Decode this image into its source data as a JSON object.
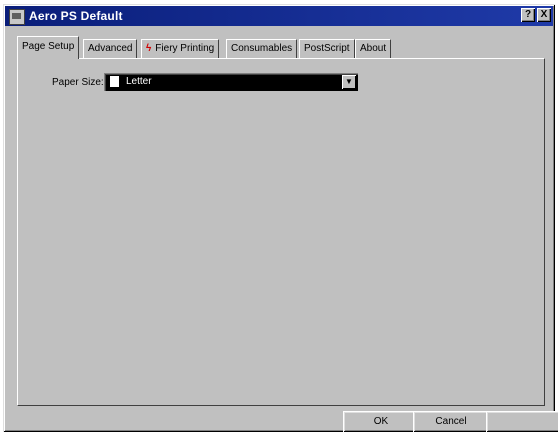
{
  "window": {
    "title": "Aero PS Default"
  },
  "titlebar": {
    "help_label": "?",
    "close_label": "X"
  },
  "tabs": [
    {
      "label": "Page Setup",
      "active": true
    },
    {
      "label": "Advanced"
    },
    {
      "label": "Fiery Printing",
      "icon": "fiery-icon"
    },
    {
      "label": "Consumables"
    },
    {
      "label": "PostScript"
    },
    {
      "label": "About"
    }
  ],
  "paper_size": {
    "label": "Paper Size:",
    "value": "Letter"
  },
  "buttons": {
    "ok": "OK",
    "cancel": "Cancel",
    "apply": ""
  }
}
